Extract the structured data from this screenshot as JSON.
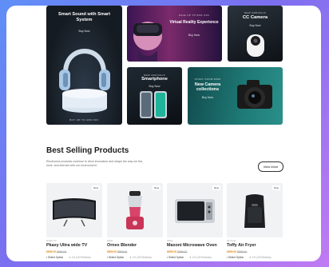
{
  "banners": {
    "sound": {
      "title": "Smart Sound with Smart System",
      "cta": "Buy Now",
      "footer": "BUY UP TO 40% OFF"
    },
    "vr": {
      "tag": "SALE UP TO 50% OFF",
      "title": "Virtual Reality Experience",
      "cta": "Buy Now"
    },
    "cc": {
      "tag": "NEW ARRIVALS",
      "title": "CC Camera",
      "cta": "Buy Now"
    },
    "phone": {
      "tag": "NEW ARRIVALS",
      "title": "Smartphone",
      "cta": "Buy Now"
    },
    "camera": {
      "tag": "START FROM $999",
      "title": "New Camera collections",
      "cta": "Buy Now"
    }
  },
  "best_selling": {
    "title": "Best Selling Products",
    "description": "Electronics products continue to drive innovation and shape the way we live, work, and interact with our environment.",
    "view_more": "View More"
  },
  "products": [
    {
      "badge": "New",
      "category": "Smart TV",
      "name": "Pkaxy Ultra wide TV",
      "price": "$899.00",
      "old_price": "$999.00",
      "option": "• Select Option",
      "reviews": "★ 4.5 (16 Reviews)"
    },
    {
      "badge": "New",
      "category": "Other",
      "name": "Ornex Blender",
      "price": "$899.00",
      "old_price": "$999.00",
      "option": "• Select Option",
      "reviews": "★ 4.5 (16 Reviews)"
    },
    {
      "badge": "New",
      "category": "Other",
      "name": "Maxoni Microwave Oven",
      "price": "$899.00",
      "old_price": "$999.00",
      "option": "• Select Option",
      "reviews": "★ 4.5 (16 Reviews)"
    },
    {
      "badge": "New",
      "category": "Air Fryer",
      "name": "Toffy Air Fryer",
      "price": "$899.00",
      "old_price": "$999.00",
      "option": "• Select Option",
      "reviews": "★ 4.5 (16 Reviews)"
    }
  ]
}
